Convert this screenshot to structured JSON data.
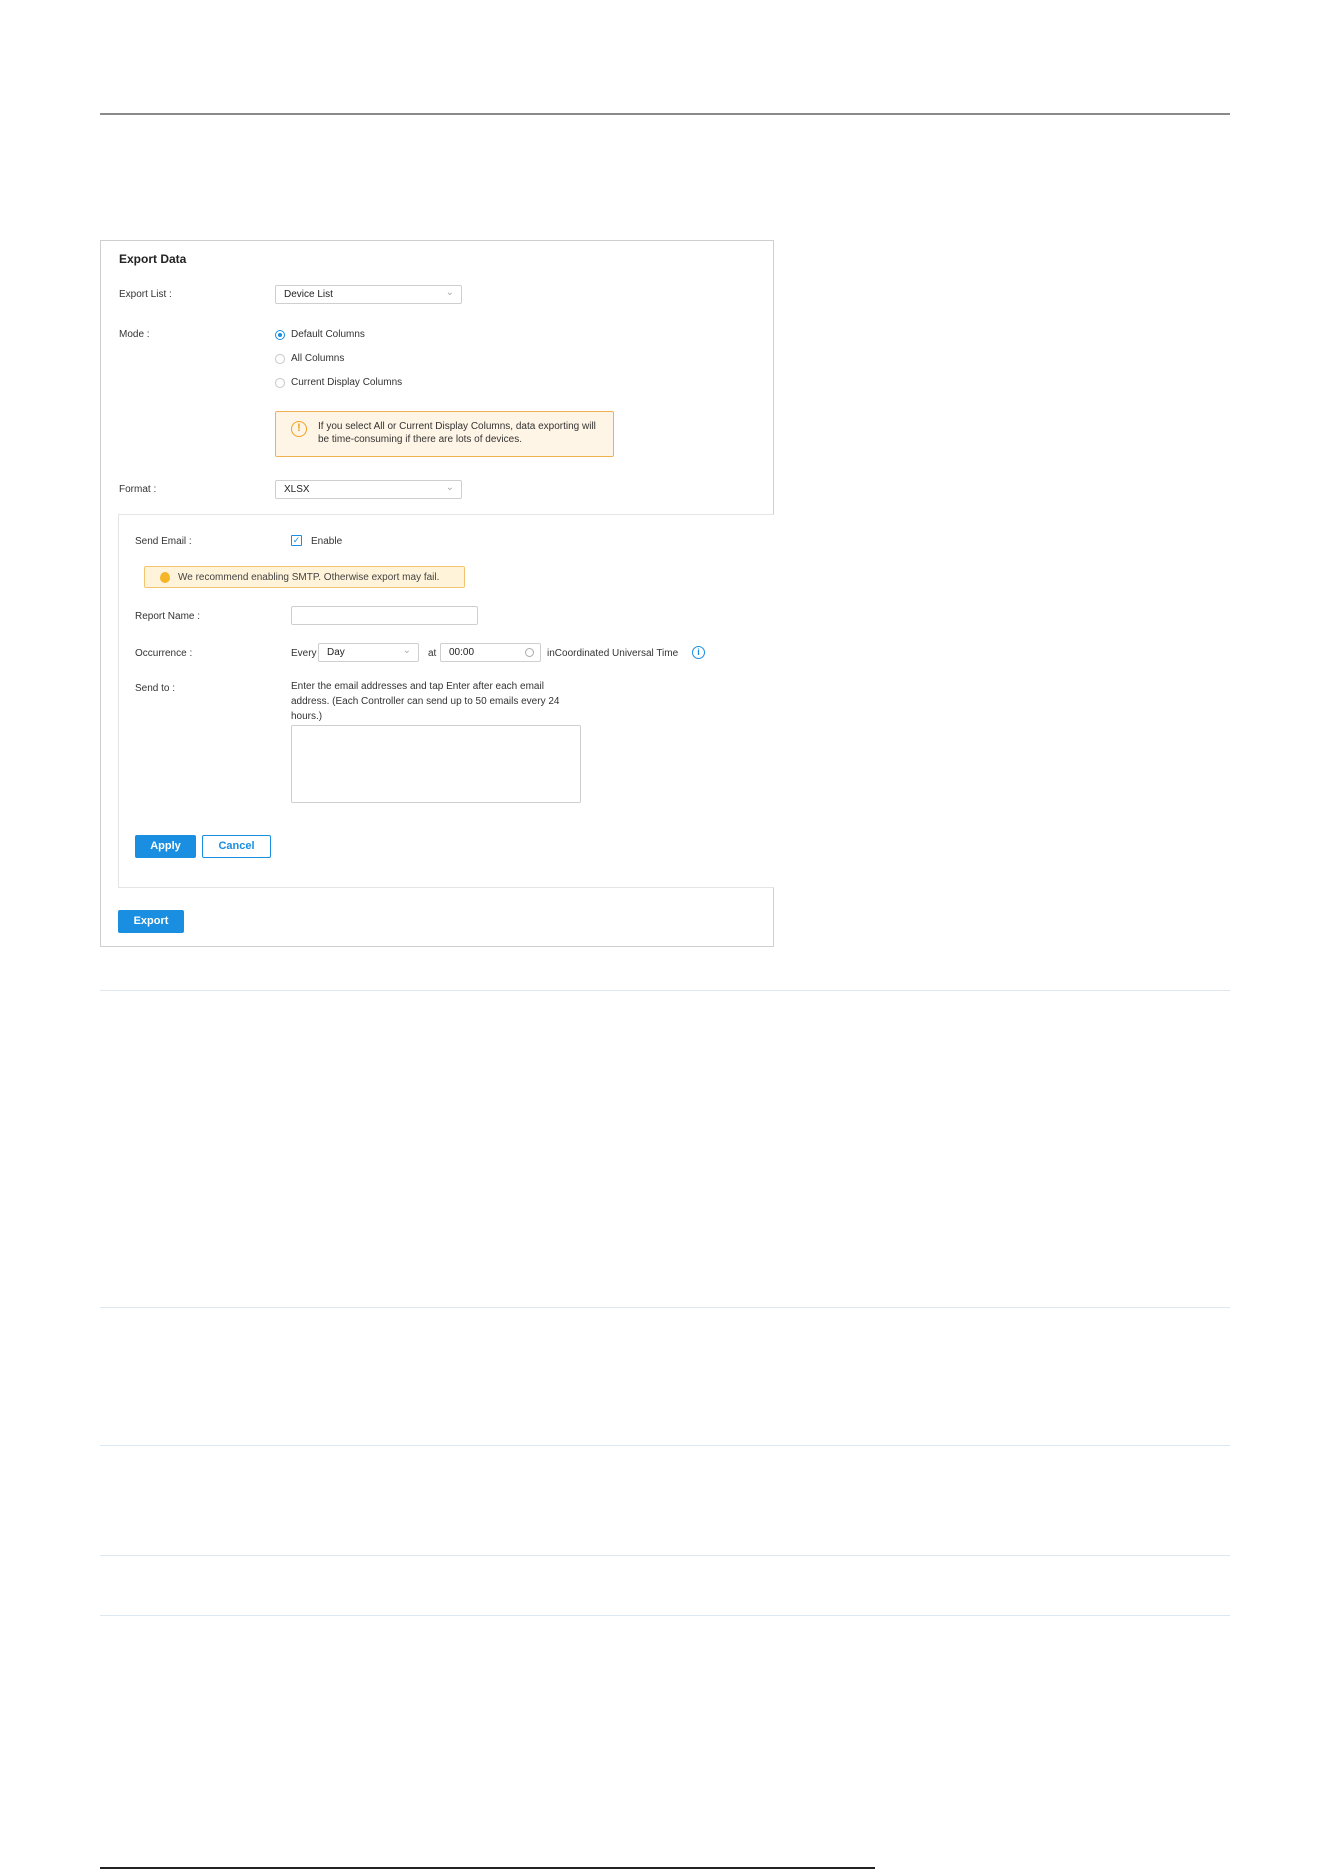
{
  "export_panel": {
    "title": "Export Data",
    "export_list": {
      "label": "Export List :",
      "value": "Device List"
    },
    "mode": {
      "label": "Mode :",
      "options": [
        "Default Columns",
        "All Columns",
        "Current Display Columns"
      ],
      "selected": "Default Columns"
    },
    "mode_warning": "If you select All or Current Display Columns, data exporting will be time-consuming if there are lots of devices.",
    "format": {
      "label": "Format :",
      "value": "XLSX"
    },
    "send_email": {
      "label": "Send Email :",
      "enable_label": "Enable",
      "enabled": true,
      "smtp_notice": "We recommend enabling SMTP. Otherwise export may fail.",
      "report_name_label": "Report Name :",
      "report_name_value": "",
      "occurrence": {
        "label": "Occurrence :",
        "every_label": "Every",
        "period_value": "Day",
        "at_label": "at",
        "time_value": "00:00",
        "timezone_text": "inCoordinated Universal Time"
      },
      "send_to": {
        "label": "Send to :",
        "hint": "Enter the email addresses and tap Enter after each email address. (Each Controller can send up to 50 emails every 24 hours.)",
        "value": ""
      },
      "apply_label": "Apply",
      "cancel_label": "Cancel"
    },
    "export_label": "Export"
  },
  "colors": {
    "accent": "#1a8ee0",
    "warning_border": "#f0b152",
    "warning_bg": "#fff5e6"
  },
  "icons": [
    "chevron-down-icon",
    "warning-icon",
    "bulb-icon",
    "clock-icon",
    "info-icon",
    "checkmark-icon"
  ]
}
